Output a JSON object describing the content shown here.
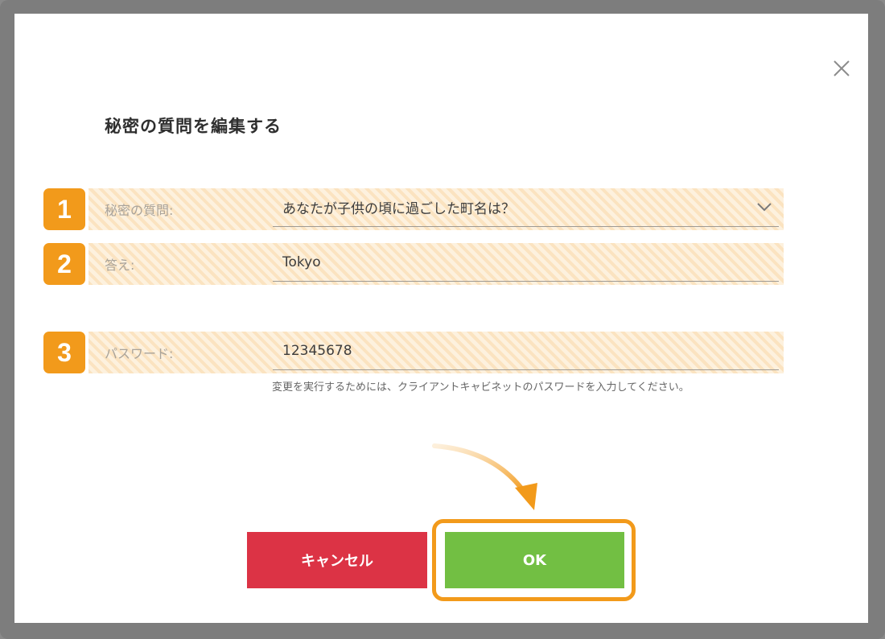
{
  "dialog": {
    "title": "秘密の質問を編集する",
    "close_icon": "close-icon"
  },
  "fields": [
    {
      "badge": "1",
      "label": "秘密の質問:",
      "value": "あなたが子供の頃に過ごした町名は？",
      "type": "select",
      "icon": "chevron-down-icon"
    },
    {
      "badge": "2",
      "label": "答え:",
      "value": "Tokyo",
      "type": "text"
    },
    {
      "badge": "3",
      "label": "パスワード:",
      "value": "12345678",
      "type": "password"
    }
  ],
  "hint": "変更を実行するためには、クライアントキャビネットのパスワードを入力してください。",
  "buttons": {
    "cancel": "キャンセル",
    "ok": "OK"
  },
  "colors": {
    "accent": "#f29a1b",
    "cancel": "#dc3345",
    "ok": "#72bf43"
  }
}
